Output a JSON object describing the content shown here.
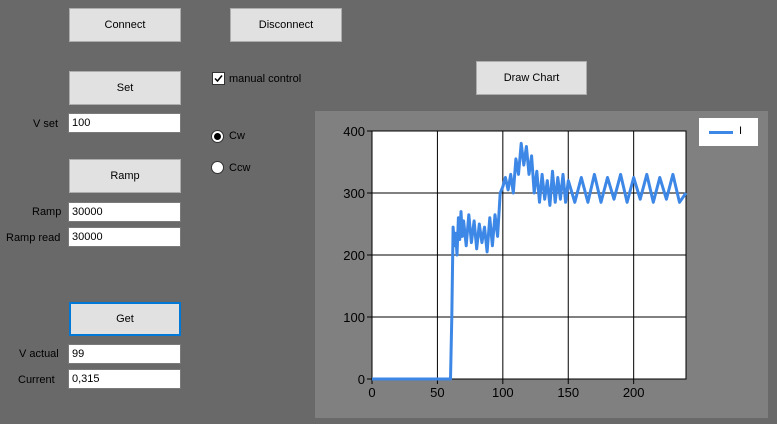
{
  "buttons": {
    "connect": "Connect",
    "disconnect": "Disconnect",
    "set": "Set",
    "ramp": "Ramp",
    "get": "Get",
    "draw_chart": "Draw Chart"
  },
  "fields": {
    "v_set": {
      "label": "V set",
      "value": "100"
    },
    "ramp": {
      "label": "Ramp",
      "value": "30000"
    },
    "ramp_read": {
      "label": "Ramp read",
      "value": "30000"
    },
    "v_actual": {
      "label": "V actual",
      "value": "99"
    },
    "current": {
      "label": "Current",
      "value": "0,315"
    }
  },
  "manual_control": {
    "label": "manual control",
    "checked": true
  },
  "direction": {
    "options": [
      {
        "label": "Cw",
        "selected": true
      },
      {
        "label": "Ccw",
        "selected": false
      }
    ]
  },
  "chart_data": {
    "type": "line",
    "xlim": [
      0,
      240
    ],
    "ylim": [
      0,
      400
    ],
    "xticks": [
      0,
      50,
      100,
      150,
      200
    ],
    "yticks": [
      0,
      100,
      200,
      300,
      400
    ],
    "grid": true,
    "legend_position": "top-right",
    "series": [
      {
        "name": "I",
        "color": "#3d87e6",
        "x": [
          0,
          20,
          40,
          60,
          61,
          62,
          63,
          64,
          65,
          66,
          67,
          68,
          69,
          70,
          72,
          74,
          76,
          78,
          80,
          82,
          84,
          86,
          88,
          90,
          92,
          94,
          96,
          98,
          100,
          102,
          104,
          106,
          108,
          110,
          112,
          114,
          116,
          118,
          120,
          122,
          124,
          126,
          128,
          130,
          132,
          134,
          136,
          138,
          140,
          142,
          144,
          146,
          148,
          150,
          155,
          160,
          165,
          170,
          175,
          180,
          185,
          190,
          195,
          200,
          205,
          210,
          215,
          220,
          225,
          230,
          235,
          240
        ],
        "values": [
          0,
          0,
          0,
          0,
          100,
          245,
          215,
          235,
          200,
          260,
          225,
          270,
          230,
          255,
          215,
          265,
          220,
          255,
          210,
          250,
          220,
          245,
          205,
          260,
          215,
          265,
          230,
          300,
          310,
          325,
          305,
          330,
          300,
          355,
          330,
          380,
          345,
          375,
          330,
          360,
          300,
          335,
          285,
          330,
          290,
          320,
          280,
          335,
          285,
          325,
          290,
          330,
          285,
          320,
          285,
          325,
          285,
          330,
          285,
          325,
          290,
          330,
          285,
          325,
          290,
          330,
          285,
          325,
          290,
          330,
          285,
          300
        ]
      }
    ]
  }
}
